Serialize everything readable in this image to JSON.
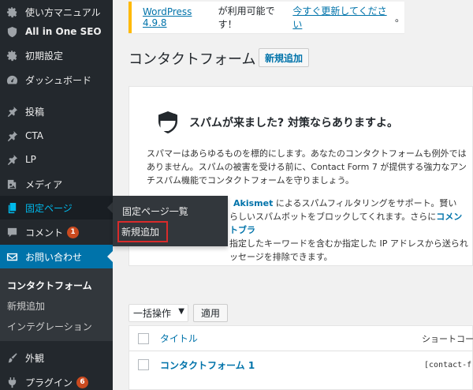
{
  "notice": {
    "version_link": "WordPress 4.9.8",
    "middle_text": " が利用可能です！",
    "update_link": "今すぐ更新してください",
    "end_text": "。"
  },
  "page": {
    "title": "コンタクトフォーム",
    "add_new_label": "新規追加"
  },
  "sidebar": {
    "items": [
      {
        "label": "使い方マニュアル",
        "icon": "gear-icon"
      },
      {
        "label": "All in One SEO",
        "icon": "shield-icon"
      },
      {
        "label": "初期設定",
        "icon": "gear-icon"
      },
      {
        "label": "ダッシュボード",
        "icon": "dashboard-icon"
      },
      {
        "label": "投稿",
        "icon": "pin-icon"
      },
      {
        "label": "CTA",
        "icon": "pin-icon"
      },
      {
        "label": "LP",
        "icon": "pin-icon"
      },
      {
        "label": "メディア",
        "icon": "media-icon"
      },
      {
        "label": "固定ページ",
        "icon": "pages-icon"
      },
      {
        "label": "コメント",
        "icon": "comment-icon",
        "badge": "1"
      },
      {
        "label": "お問い合わせ",
        "icon": "mail-icon"
      },
      {
        "label": "外観",
        "icon": "brush-icon"
      },
      {
        "label": "プラグイン",
        "icon": "plugin-icon",
        "badge": "6"
      }
    ],
    "contact_submenu": [
      "コンタクトフォーム",
      "新規追加",
      "インテグレーション"
    ]
  },
  "flyout": {
    "items": [
      "固定ページ一覧",
      "新規追加"
    ]
  },
  "spam_box": {
    "heading": "スパムが来ました? 対策ならありますよ。",
    "para1": "スパマーはあらゆるものを標的にします。あなたのコンタクトフォームも例外ではありません。スパムの被害を受ける前に、Contact Form 7 が提供する強力なアンチスパム機能でコンタクトフォームを守りましょう。",
    "para2_line1_bold": "Akismet",
    "para2_line1": " によるスパムフィルタリングをサポート。賢い",
    "para2_line2": "らしいスパムボットをブロックしてくれます。さらに",
    "para2_line2_link": "コメントブラ",
    "para2_line3": "指定したキーワードを含むか指定した IP アドレスから送られ",
    "para2_line4": "ッセージを排除できます。"
  },
  "bulk": {
    "select_value": "一括操作",
    "apply_label": "適用"
  },
  "table": {
    "columns": {
      "title": "タイトル",
      "shortcode": "ショートコー"
    },
    "rows": [
      {
        "title": "コンタクトフォーム 1",
        "shortcode": "[contact-f"
      }
    ]
  },
  "colors": {
    "sidebar_bg": "#23282d",
    "accent": "#0073aa",
    "badge": "#ca4a1f",
    "notice_border": "#ffb900",
    "highlight_box": "#d92b2b"
  }
}
